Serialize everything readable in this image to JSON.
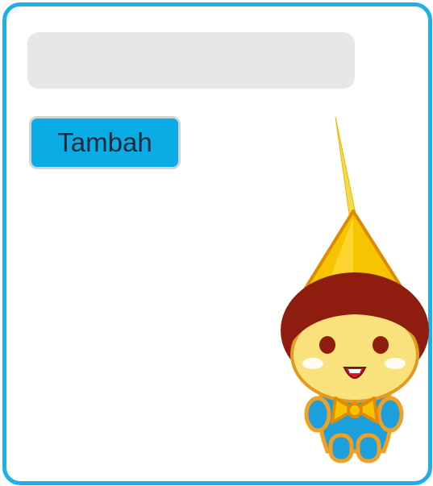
{
  "input": {
    "value": "",
    "placeholder": ""
  },
  "add_button": {
    "label": "Tambah"
  },
  "colors": {
    "frame_border": "#1bb0ea",
    "input_bg": "#e6e7e8",
    "button_bg": "#0aace6",
    "button_border": "#d1d3d4"
  },
  "mascot": {
    "icon": "mascot-character-icon"
  }
}
